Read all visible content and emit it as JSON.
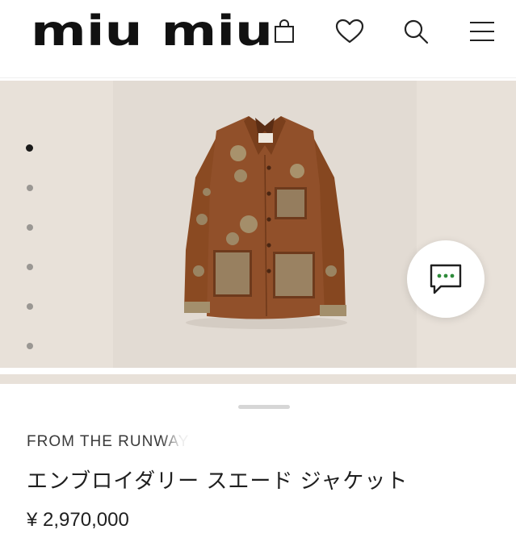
{
  "header": {
    "brand": "miu miu",
    "icons": [
      "shopping-bag-icon",
      "heart-icon",
      "search-icon",
      "menu-icon"
    ]
  },
  "gallery": {
    "image_count": 6,
    "active_index": 0,
    "chat_icon": "chat-bubble-icon",
    "chat_dots_color": "#2e8b3a"
  },
  "product": {
    "collection": "FROM THE RUNWAY",
    "name": "エンブロイダリー スエード ジャケット",
    "price": "¥ 2,970,000"
  },
  "colors": {
    "gallery_bg": "#e8e1d9",
    "jacket": "#8a4a22",
    "text": "#1f1f1f"
  }
}
